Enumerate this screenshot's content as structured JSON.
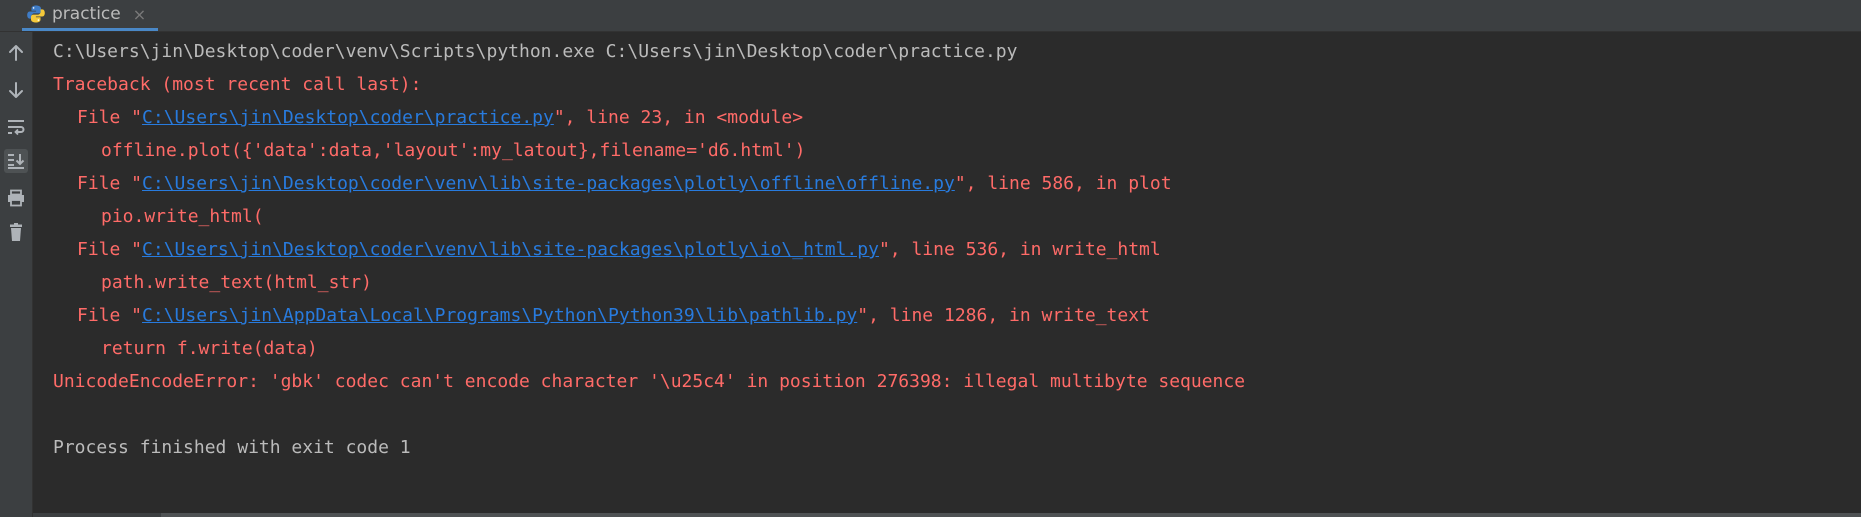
{
  "tab": {
    "label": "practice",
    "icon": "python-icon",
    "close_symbol": "×"
  },
  "toolbar": {
    "items": [
      {
        "icon": "arrow-up-icon",
        "active": false
      },
      {
        "icon": "arrow-down-icon",
        "active": false
      },
      {
        "icon": "soft-wrap-icon",
        "active": false
      },
      {
        "icon": "scroll-to-end-icon",
        "active": true
      },
      {
        "icon": "print-icon",
        "active": false
      },
      {
        "icon": "trash-icon",
        "active": false
      }
    ]
  },
  "console": {
    "command": "C:\\Users\\jin\\Desktop\\coder\\venv\\Scripts\\python.exe C:\\Users\\jin\\Desktop\\coder\\practice.py",
    "traceback_header": "Traceback (most recent call last):",
    "frames": [
      {
        "prefix": "File \"",
        "path": "C:\\Users\\jin\\Desktop\\coder\\practice.py",
        "suffix": "\", line 23, in <module>",
        "code": "offline.plot({'data':data,'layout':my_latout},filename='d6.html')"
      },
      {
        "prefix": "File \"",
        "path": "C:\\Users\\jin\\Desktop\\coder\\venv\\lib\\site-packages\\plotly\\offline\\offline.py",
        "suffix": "\", line 586, in plot",
        "code": "pio.write_html("
      },
      {
        "prefix": "File \"",
        "path": "C:\\Users\\jin\\Desktop\\coder\\venv\\lib\\site-packages\\plotly\\io\\_html.py",
        "suffix": "\", line 536, in write_html",
        "code": "path.write_text(html_str)"
      },
      {
        "prefix": "File \"",
        "path": "C:\\Users\\jin\\AppData\\Local\\Programs\\Python\\Python39\\lib\\pathlib.py",
        "suffix": "\", line 1286, in write_text",
        "code": "return f.write(data)"
      }
    ],
    "error": "UnicodeEncodeError: 'gbk' codec can't encode character '\\u25c4' in position 276398: illegal multibyte sequence",
    "exit_message": "Process finished with exit code 1"
  },
  "colors": {
    "background": "#2b2b2b",
    "panel": "#3c3f41",
    "error_text": "#ff6b68",
    "link": "#287bde",
    "normal_text": "#bbbbbb"
  }
}
